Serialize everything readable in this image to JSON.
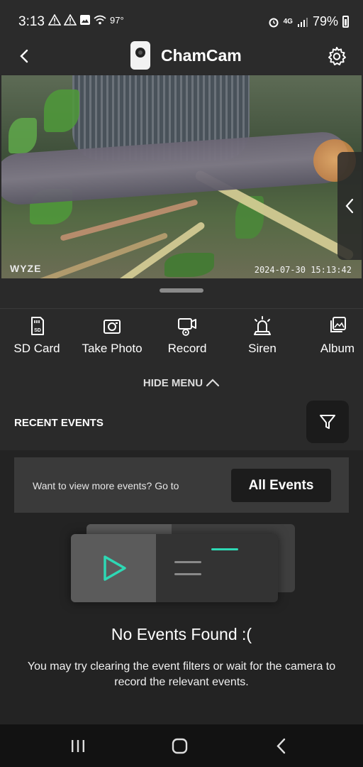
{
  "status_bar": {
    "time": "3:13",
    "temperature": "97°",
    "network": "4G",
    "battery": "79%"
  },
  "header": {
    "title": "ChamCam"
  },
  "video": {
    "brand": "WYZE",
    "timestamp": "2024-07-30 15:13:42"
  },
  "actions": [
    {
      "label": "SD Card",
      "icon": "sd-card-icon"
    },
    {
      "label": "Take Photo",
      "icon": "camera-icon"
    },
    {
      "label": "Record",
      "icon": "record-icon"
    },
    {
      "label": "Siren",
      "icon": "siren-icon"
    },
    {
      "label": "Album",
      "icon": "album-icon"
    }
  ],
  "hide_menu_label": "HIDE MENU",
  "recent_events": {
    "title": "RECENT EVENTS",
    "more_text": "Want to view more events? Go to",
    "all_events_label": "All Events",
    "empty_title": "No Events Found :(",
    "empty_desc": "You may try clearing the event filters or wait for the camera to record the relevant events."
  },
  "colors": {
    "background": "#2a2a2a",
    "accent_teal": "#2ed8b4"
  }
}
